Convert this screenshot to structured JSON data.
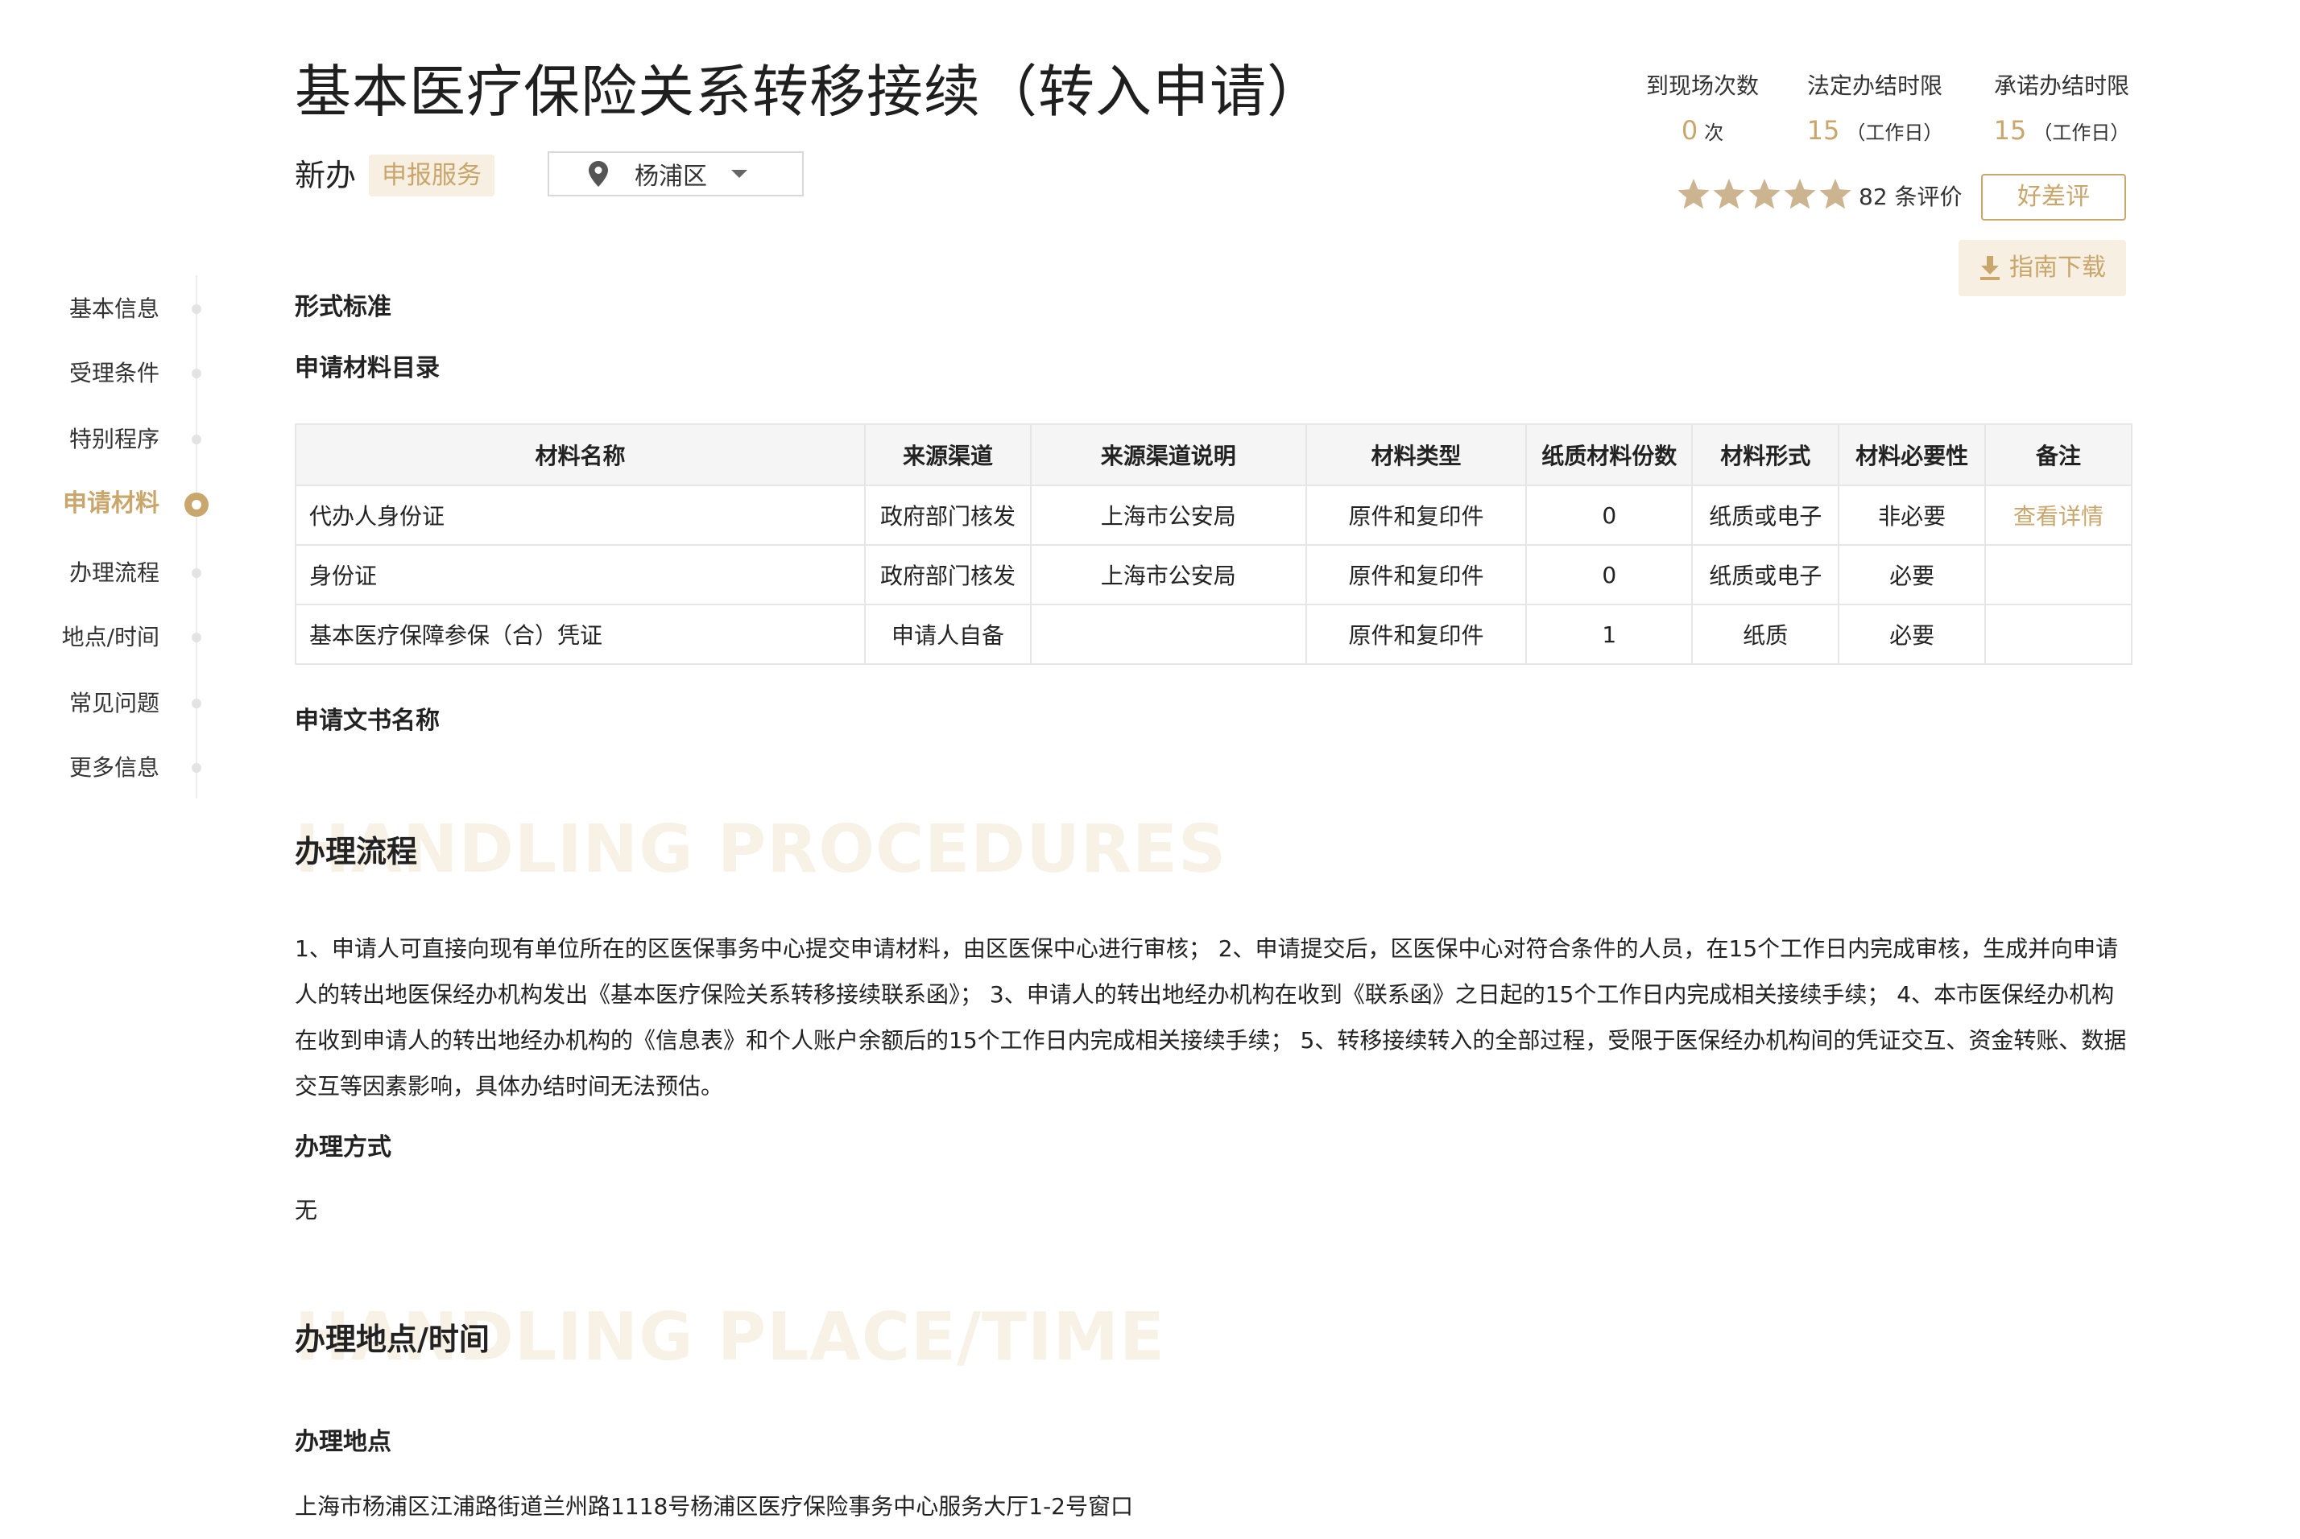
{
  "header": {
    "title": "基本医疗保险关系转移接续（转入申请）",
    "subtype": "新办",
    "service_tag": "申报服务",
    "region": "杨浦区"
  },
  "stats": [
    {
      "label": "到现场次数",
      "value": "0",
      "unit": "次"
    },
    {
      "label": "法定办结时限",
      "value": "15",
      "unit": "（工作日）"
    },
    {
      "label": "承诺办结时限",
      "value": "15",
      "unit": "（工作日）"
    }
  ],
  "rating": {
    "stars": 5,
    "count_text": "82 条评价",
    "rate_button": "好差评",
    "guide_button": "指南下载"
  },
  "sidenav": [
    {
      "label": "基本信息",
      "active": false
    },
    {
      "label": "受理条件",
      "active": false
    },
    {
      "label": "特别程序",
      "active": false
    },
    {
      "label": "申请材料",
      "active": true
    },
    {
      "label": "办理流程",
      "active": false
    },
    {
      "label": "地点/时间",
      "active": false
    },
    {
      "label": "常见问题",
      "active": false
    },
    {
      "label": "更多信息",
      "active": false
    }
  ],
  "materials": {
    "form_standard": "形式标准",
    "catalog_title": "申请材料目录",
    "columns": [
      "材料名称",
      "来源渠道",
      "来源渠道说明",
      "材料类型",
      "纸质材料份数",
      "材料形式",
      "材料必要性",
      "备注"
    ],
    "rows": [
      [
        "代办人身份证",
        "政府部门核发",
        "上海市公安局",
        "原件和复印件",
        "0",
        "纸质或电子",
        "非必要",
        "查看详情"
      ],
      [
        "身份证",
        "政府部门核发",
        "上海市公安局",
        "原件和复印件",
        "0",
        "纸质或电子",
        "必要",
        ""
      ],
      [
        "基本医疗保障参保（合）凭证",
        "申请人自备",
        "",
        "原件和复印件",
        "1",
        "纸质",
        "必要",
        ""
      ]
    ],
    "doc_name_title": "申请文书名称"
  },
  "procedure": {
    "title": "办理流程",
    "bg_text": "HANDLING PROCEDURES",
    "text": "1、申请人可直接向现有单位所在的区医保事务中心提交申请材料，由区医保中心进行审核； 2、申请提交后，区医保中心对符合条件的人员，在15个工作日内完成审核，生成并向申请人的转出地医保经办机构发出《基本医疗保险关系转移接续联系函》； 3、申请人的转出地经办机构在收到《联系函》之日起的15个工作日内完成相关接续手续； 4、本市医保经办机构在收到申请人的转出地经办机构的《信息表》和个人账户余额后的15个工作日内完成相关接续手续； 5、转移接续转入的全部过程，受限于医保经办机构间的凭证交互、资金转账、数据交互等因素影响，具体办结时间无法预估。",
    "method_title": "办理方式",
    "method_value": "无"
  },
  "place": {
    "title": "办理地点/时间",
    "bg_text": "HANDLING PLACE/TIME",
    "place_title": "办理地点",
    "place_value": "上海市杨浦区江浦路街道兰州路1118号杨浦区医疗保险事务中心服务大厅1-2号窗口"
  },
  "colors": {
    "accent": "#c9a66b",
    "accent_bg": "#f6efe2",
    "text": "#222222"
  }
}
